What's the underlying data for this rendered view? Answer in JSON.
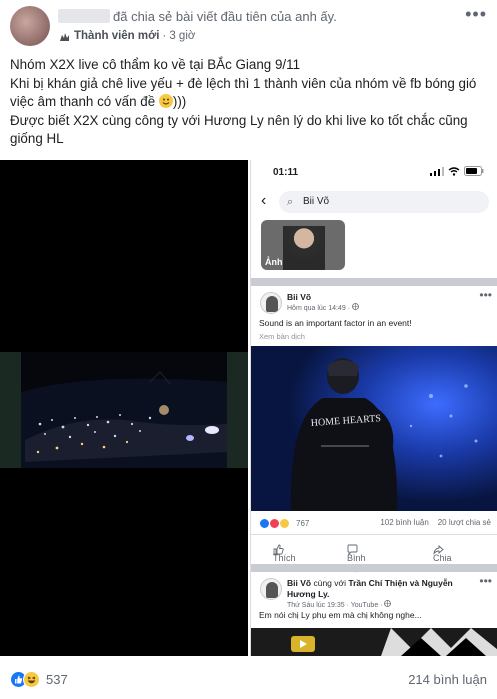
{
  "post": {
    "header_text": "đã chia sẻ bài viết đầu tiên của anh ấy.",
    "member_badge": "Thành viên mới",
    "dot": "·",
    "time": "3 giờ",
    "more": "•••",
    "lines": [
      "Nhóm X2X live cô thẩm ko về tại BẮc Giang 9/11",
      "Khi bị khán giả chê live yếu + đè lệch thì 1 thành viên của nhóm về fb bóng gió việc âm thanh có vấn đề",
      ")))",
      "Được biết X2X cùng công ty với Hương Ly nên lý do khi live ko tốt chắc cũng giống HL"
    ],
    "reaction_count": "537",
    "comment_count": "214 bình luận"
  },
  "phone": {
    "time": "01:11",
    "search_value": "Bii Võ",
    "photo_label": "Ảnh",
    "post1": {
      "author": "Bii Võ",
      "sub": "Hôm qua lúc 14:49 ·",
      "text": "Sound is an important factor in an event!",
      "translate": "Xem bản dịch",
      "reactions": "767",
      "comments": "102 bình luận",
      "shares": "20 lượt chia sẻ",
      "like": "Thích",
      "comment": "Bình luận",
      "share": "Chia sẻ",
      "jacket_text": "HOME HEARTS"
    },
    "post2": {
      "author": "Bii Võ",
      "with": "cùng với",
      "tagged": "Trần Chí Thiện và Nguyễn Hương Ly.",
      "sub": "Thứ Sáu lúc 19:35 · YouTube ·",
      "text": "Em nói chị Ly phụ em mà chị không nghe...",
      "dots": "•••"
    }
  },
  "colors": {
    "like_blue": "#1877f2",
    "love_red": "#f33e58",
    "haha_yellow": "#f7c843",
    "text_muted": "#606770"
  }
}
